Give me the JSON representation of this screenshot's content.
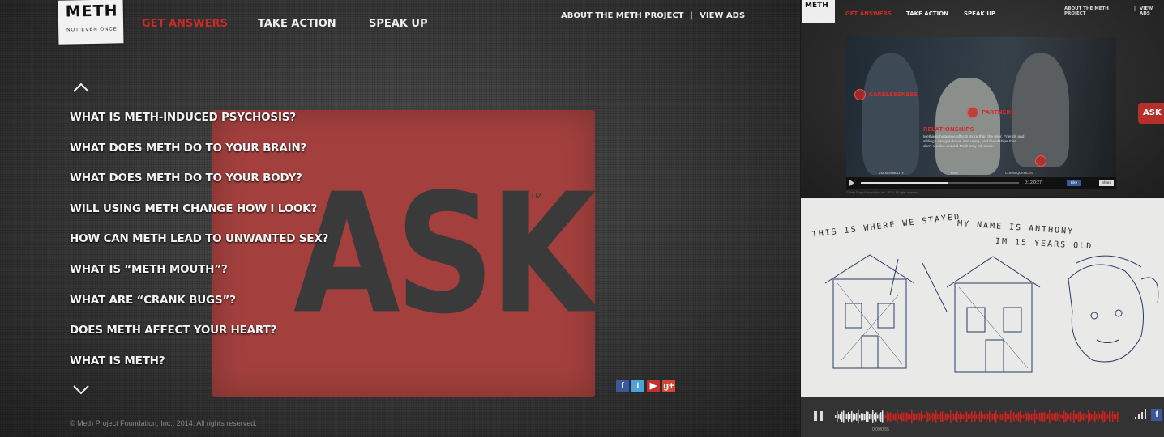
{
  "main": {
    "logo": {
      "word": "METH",
      "tagline": "NOT EVEN ONCE."
    },
    "nav": {
      "get_answers": "GET ANSWERS",
      "take_action": "TAKE ACTION",
      "speak_up": "SPEAK UP"
    },
    "top_links": {
      "about": "ABOUT THE METH PROJECT",
      "separator": "|",
      "view_ads": "VIEW ADS"
    },
    "ask": {
      "word": "ASK",
      "trademark": "TM"
    },
    "questions": [
      "WHAT IS METH-INDUCED PSYCHOSIS?",
      "WHAT DOES METH DO TO YOUR BRAIN?",
      "WHAT DOES METH DO TO YOUR BODY?",
      "WILL USING METH CHANGE HOW I LOOK?",
      "HOW CAN METH LEAD TO UNWANTED SEX?",
      "WHAT IS “METH MOUTH”?",
      "WHAT ARE “CRANK BUGS”?",
      "DOES METH AFFECT YOUR HEART?",
      "WHAT IS METH?"
    ],
    "social": [
      "facebook-icon",
      "twitter-icon",
      "youtube-icon",
      "google-plus-icon"
    ],
    "copyright": "© Meth Project Foundation, Inc., 2014. All rights reserved.",
    "colors": {
      "accent_red": "#c62b26",
      "ask_box": "#a3403d"
    }
  },
  "right_top": {
    "logo": "METH",
    "nav": {
      "get_answers": "GET ANSWERS",
      "take_action": "TAKE ACTION",
      "speak_up": "SPEAK UP"
    },
    "top_links": {
      "about": "ABOUT THE METH PROJECT",
      "separator": "|",
      "view_ads": "VIEW ADS"
    },
    "hotspots": {
      "carelessness": "CARELESSNESS",
      "partners": "PARTNERS"
    },
    "relationships": {
      "title": "RELATIONSHIPS",
      "text": "Methamphetamine affects more than the user. Friends and siblings can get drawn into using, and friendships that don't revolve around Meth may fall apart."
    },
    "video_bar": {
      "chapters": [
        "VULNERABILITY",
        "RISK",
        "CONSEQUENCES"
      ],
      "time": "0:12/0:27",
      "like": "Like",
      "share": "Share",
      "progress": 0.55
    },
    "copyright": "© Meth Project Foundation, Inc., 2014. All rights reserved.",
    "ask_tab": "ASK"
  },
  "right_bottom": {
    "handwriting": {
      "line1": "THIS IS WHERE WE STAYED",
      "line2": "MY NAME IS ANTHONY",
      "line3": "IM 15 YEARS OLD"
    },
    "audio": {
      "time": "0:09/0:55",
      "progress": 0.17
    }
  }
}
